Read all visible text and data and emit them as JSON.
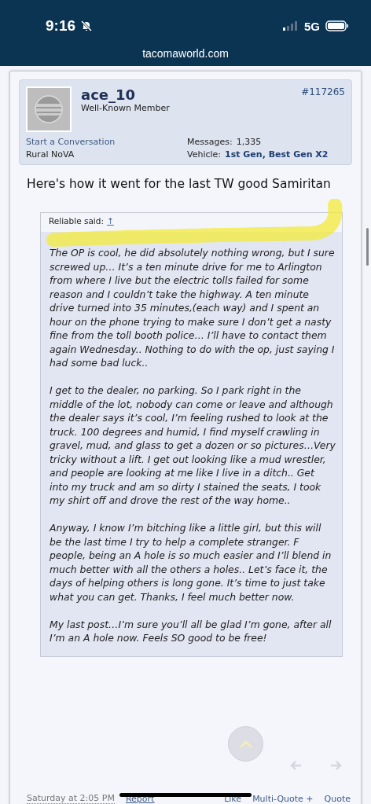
{
  "status_bar": {
    "time": "9:16",
    "network": "5G"
  },
  "address_bar": {
    "url": "tacomaworld.com"
  },
  "post": {
    "author": "ace_10",
    "role": "Well-Known Member",
    "number": "#117265",
    "links": [
      "Start a Conversation"
    ],
    "location": "Rural NoVA",
    "stats": [
      {
        "label": "Messages:",
        "value": "1,335",
        "kind": "plain"
      },
      {
        "label": "Vehicle:",
        "value": "1st Gen, Best Gen X2",
        "kind": "bold"
      }
    ],
    "message": "Here's how it went for the last TW good Samiritan",
    "quote": {
      "attribution": "Reliable said:",
      "jump": "↑",
      "paragraphs": [
        "The OP is cool, he did absolutely nothing wrong, but I sure screwed up… It’s a ten minute drive for me to Arlington from where I live but the electric tolls failed for some reason and I couldn’t take the highway. A ten minute drive turned into 35 minutes,(each way) and I spent an hour on the phone trying to make sure I don’t get a nasty fine from the toll booth police… I’ll have to contact them again Wednesday.. Nothing to do with the op, just saying I had some bad luck..",
        "I get to the dealer, no parking. So I park right in the middle of the lot, nobody can come or leave and although the dealer says it’s cool, I’m feeling rushed to look at the truck. 100 degrees and humid, I find myself crawling in gravel, mud, and glass to get a dozen or so pictures…Very tricky without a lift. I get out looking like a mud wrestler, and people are looking at me like I live in a ditch.. Get into my truck and am so dirty I stained the seats, I took my shirt off and drove the rest of the way home..",
        "Anyway, I know I’m bitching like a little girl, but this will be the last time I try to help a complete stranger. F people, being an A hole is so much easier and I’ll blend in much better with all the others a holes.. Let’s face it, the days of helping others is long gone. It’s time to just take what you can get. Thanks, I feel much better now.",
        "My last post…I’m sure you’ll all be glad I’m gone, after all I’m an A hole now. Feels SO good to be free!"
      ]
    },
    "footer": {
      "date": "Saturday at 2:05 PM",
      "actions": [
        "Report",
        "Like",
        "Multi-Quote +",
        "Quote"
      ]
    }
  }
}
